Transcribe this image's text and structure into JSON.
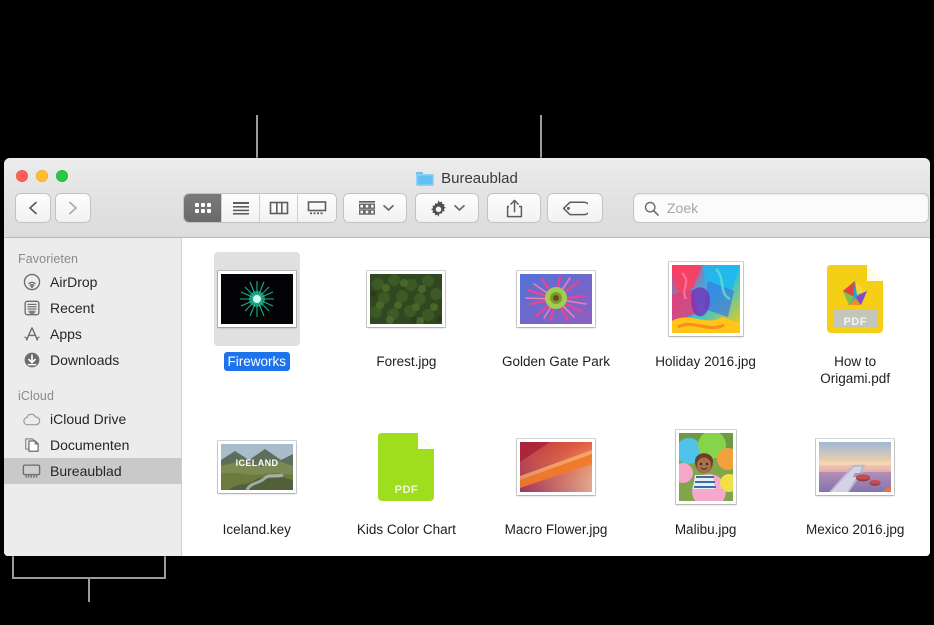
{
  "window": {
    "title": "Bureaublad",
    "folder_icon": "folder-icon",
    "traffic_lights": [
      "close",
      "minimize",
      "zoom"
    ]
  },
  "nav": {
    "back_label": "Terug",
    "forward_label": "Vooruit"
  },
  "toolbar": {
    "view_segment": [
      {
        "name": "icon-view",
        "label": "Symbolen",
        "selected": true
      },
      {
        "name": "list-view",
        "label": "Lijst",
        "selected": false
      },
      {
        "name": "column-view",
        "label": "Kolommen",
        "selected": false
      },
      {
        "name": "coverflow-view",
        "label": "Cover Flow",
        "selected": false
      }
    ],
    "arrange_label": "Groepeer",
    "action_label": "Actie",
    "share_label": "Deel",
    "tags_label": "Tags"
  },
  "search": {
    "placeholder": "Zoek",
    "value": "",
    "icon": "search-icon"
  },
  "sidebar": {
    "sections": [
      {
        "header": "Favorieten",
        "items": [
          {
            "label": "AirDrop",
            "icon": "airdrop-icon",
            "selected": false
          },
          {
            "label": "Recent",
            "icon": "recent-icon",
            "selected": false
          },
          {
            "label": "Apps",
            "icon": "apps-icon",
            "selected": false
          },
          {
            "label": "Downloads",
            "icon": "downloads-icon",
            "selected": false
          }
        ]
      },
      {
        "header": "iCloud",
        "items": [
          {
            "label": "iCloud Drive",
            "icon": "cloud-icon",
            "selected": false
          },
          {
            "label": "Documenten",
            "icon": "documents-icon",
            "selected": false
          },
          {
            "label": "Bureaublad",
            "icon": "desktop-icon",
            "selected": true
          }
        ]
      }
    ]
  },
  "files": [
    {
      "name": "Fireworks",
      "kind": "image",
      "selected": true,
      "thumb": "fireworks-thumbnail"
    },
    {
      "name": "Forest.jpg",
      "kind": "image",
      "selected": false,
      "thumb": "forest-thumbnail"
    },
    {
      "name": "Golden Gate Park",
      "kind": "image",
      "selected": false,
      "thumb": "flower-thumbnail"
    },
    {
      "name": "Holiday 2016.jpg",
      "kind": "image",
      "selected": false,
      "thumb": "paint-thumbnail"
    },
    {
      "name": "How to Origami.pdf",
      "kind": "pdf",
      "selected": false,
      "thumb": "origami-pdf-icon",
      "pdf_label": "PDF",
      "pdf_color": "#f7d117"
    },
    {
      "name": "Iceland.key",
      "kind": "image",
      "selected": false,
      "thumb": "iceland-thumbnail"
    },
    {
      "name": "Kids Color Chart",
      "kind": "pdf",
      "selected": false,
      "thumb": "kids-pdf-icon",
      "pdf_label": "PDF",
      "pdf_color": "#9ede1e"
    },
    {
      "name": "Macro Flower.jpg",
      "kind": "image",
      "selected": false,
      "thumb": "macro-thumbnail"
    },
    {
      "name": "Malibu.jpg",
      "kind": "image",
      "selected": false,
      "thumb": "malibu-thumbnail"
    },
    {
      "name": "Mexico 2016.jpg",
      "kind": "image",
      "selected": false,
      "thumb": "mexico-thumbnail"
    }
  ],
  "colors": {
    "selection_blue": "#1d73ec",
    "sidebar_selected": "#c9c9c9",
    "toolbar_active": "#6b6b6b",
    "callout_line": "#9a9a9a"
  },
  "callouts": [
    {
      "name": "view-buttons-callout"
    },
    {
      "name": "share-tags-callout"
    },
    {
      "name": "sidebar-callout"
    }
  ]
}
